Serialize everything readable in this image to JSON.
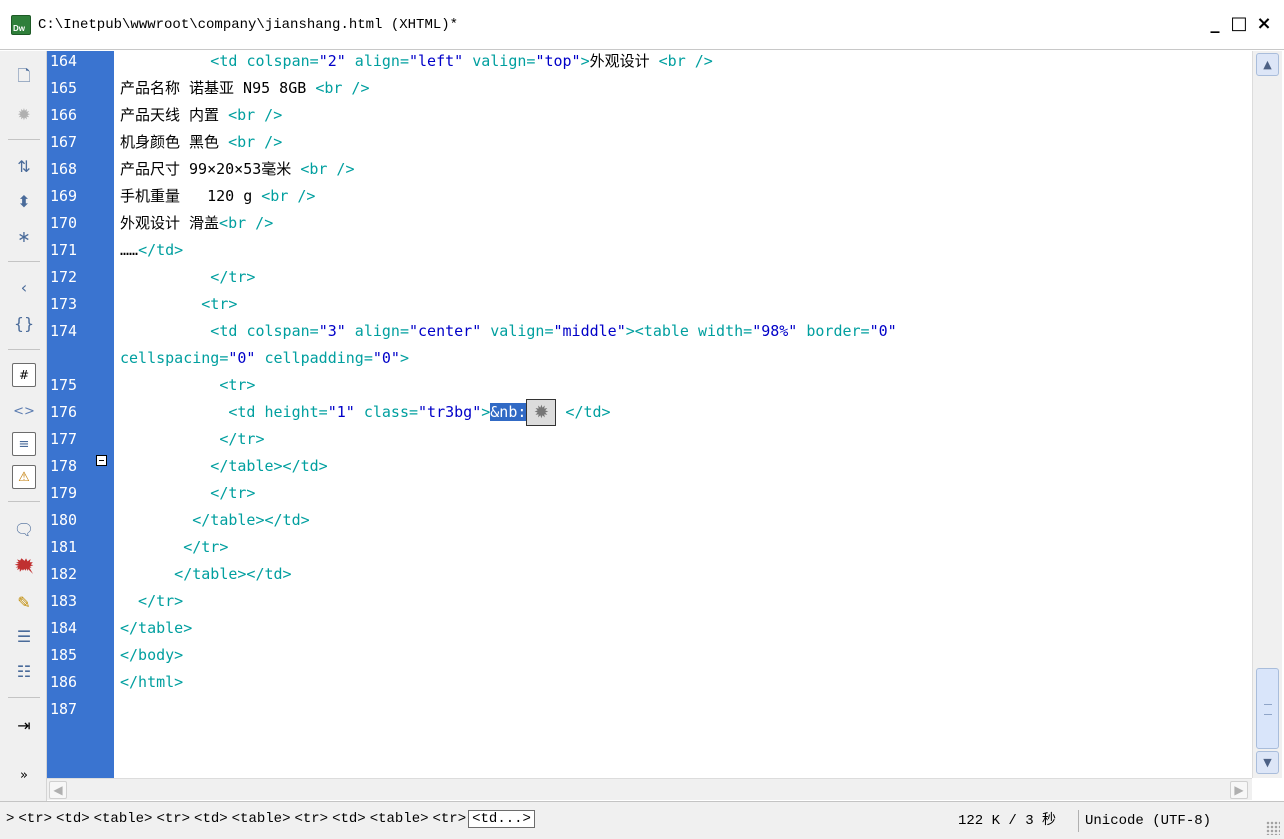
{
  "window": {
    "app_badge": "Dw",
    "title": "C:\\Inetpub\\wwwroot\\company\\jianshang.html (XHTML)*",
    "minimize": "_",
    "maximize": "□",
    "close": "×"
  },
  "toolbar": {
    "icons": [
      "open-documents-icon",
      "collapse-tag-icon",
      "expand-all-icon",
      "select-parent-tag-icon",
      "balance-braces-icon",
      "line-numbers-icon",
      "highlight-invalid-code-icon",
      "word-wrap-icon",
      "syntax-coloring-icon",
      "apply-comment-icon",
      "remove-comment-icon",
      "wrap-tag-icon",
      "recent-snippets-icon",
      "move-css-icon",
      "indent-code-icon",
      "more-icon"
    ]
  },
  "editor": {
    "lines": [
      {
        "n": "164",
        "parts": [
          [
            "tag",
            "          <td "
          ],
          [
            "tag",
            "colspan="
          ],
          [
            "val",
            "\"2\""
          ],
          [
            "tag",
            " align="
          ],
          [
            "val",
            "\"left\""
          ],
          [
            "tag",
            " valign="
          ],
          [
            "val",
            "\"top\""
          ],
          [
            "tag",
            ">"
          ],
          [
            "txt",
            "外观设计 "
          ],
          [
            "tag",
            "<br />"
          ]
        ]
      },
      {
        "n": "165",
        "parts": [
          [
            "txt",
            "产品名称 诺基亚 N95 8GB "
          ],
          [
            "tag",
            "<br />"
          ]
        ]
      },
      {
        "n": "166",
        "parts": [
          [
            "txt",
            "产品天线 内置 "
          ],
          [
            "tag",
            "<br />"
          ]
        ]
      },
      {
        "n": "167",
        "parts": [
          [
            "txt",
            "机身颜色 黑色 "
          ],
          [
            "tag",
            "<br />"
          ]
        ]
      },
      {
        "n": "168",
        "parts": [
          [
            "txt",
            "产品尺寸 99×20×53毫米 "
          ],
          [
            "tag",
            "<br />"
          ]
        ]
      },
      {
        "n": "169",
        "parts": [
          [
            "txt",
            "手机重量   120 g "
          ],
          [
            "tag",
            "<br />"
          ]
        ]
      },
      {
        "n": "170",
        "parts": [
          [
            "txt",
            "外观设计 滑盖"
          ],
          [
            "tag",
            "<br />"
          ]
        ]
      },
      {
        "n": "171",
        "parts": [
          [
            "txt",
            "……"
          ],
          [
            "tag",
            "</td>"
          ]
        ]
      },
      {
        "n": "172",
        "parts": [
          [
            "tag",
            "          </tr>"
          ]
        ]
      },
      {
        "n": "173",
        "parts": [
          [
            "tag",
            "         <tr>"
          ]
        ]
      },
      {
        "n": "174",
        "parts": [
          [
            "tag",
            "          <td "
          ],
          [
            "tag",
            "colspan="
          ],
          [
            "val",
            "\"3\""
          ],
          [
            "tag",
            " align="
          ],
          [
            "val",
            "\"center\""
          ],
          [
            "tag",
            " valign="
          ],
          [
            "val",
            "\"middle\""
          ],
          [
            "tag",
            "><table "
          ],
          [
            "tag",
            "width="
          ],
          [
            "val",
            "\"98%\""
          ],
          [
            "tag",
            " border="
          ],
          [
            "val",
            "\"0\""
          ]
        ]
      },
      {
        "n": "",
        "parts": [
          [
            "tag",
            "cellspacing="
          ],
          [
            "val",
            "\"0\""
          ],
          [
            "tag",
            " cellpadding="
          ],
          [
            "val",
            "\"0\""
          ],
          [
            "tag",
            ">"
          ]
        ]
      },
      {
        "n": "175",
        "parts": [
          [
            "tag",
            "           <tr>"
          ]
        ]
      },
      {
        "n": "176",
        "parts": [
          [
            "tag",
            "            <td "
          ],
          [
            "tag",
            "height="
          ],
          [
            "val",
            "\"1\""
          ],
          [
            "tag",
            " class="
          ],
          [
            "val",
            "\"tr3bg\""
          ],
          [
            "tag",
            ">"
          ]
        ]
      },
      {
        "n": "177",
        "parts": [
          [
            "tag",
            "           </tr>"
          ]
        ]
      },
      {
        "n": "178",
        "parts": [
          [
            "tag",
            "          </table></td>"
          ]
        ]
      },
      {
        "n": "179",
        "parts": [
          [
            "tag",
            "          </tr>"
          ]
        ]
      },
      {
        "n": "180",
        "parts": [
          [
            "tag",
            "        </table></td>"
          ]
        ]
      },
      {
        "n": "181",
        "parts": [
          [
            "tag",
            "       </tr>"
          ]
        ]
      },
      {
        "n": "182",
        "parts": [
          [
            "tag",
            "      </table></td>"
          ]
        ]
      },
      {
        "n": "183",
        "parts": [
          [
            "tag",
            "  </tr>"
          ]
        ]
      },
      {
        "n": "184",
        "parts": [
          [
            "tag",
            "</table>"
          ]
        ]
      },
      {
        "n": "185",
        "parts": [
          [
            "tag",
            "</body>"
          ]
        ]
      },
      {
        "n": "186",
        "parts": [
          [
            "tag",
            "</html>"
          ]
        ]
      },
      {
        "n": "187",
        "parts": []
      }
    ],
    "selected_entity": "&nb:",
    "line176_tail": " </td>"
  },
  "scrollbar": {
    "up": "▲",
    "down": "▼",
    "left": "◀",
    "right": "▶"
  },
  "statusbar": {
    "tag_selector": [
      "<tr>",
      "<td>",
      "<table>",
      "<tr>",
      "<td>",
      "<table>",
      "<tr>",
      "<td>",
      "<table>",
      "<tr>"
    ],
    "active_tag": "<td...>",
    "size": "122 K / 3 秒",
    "encoding": "Unicode (UTF-8)"
  }
}
